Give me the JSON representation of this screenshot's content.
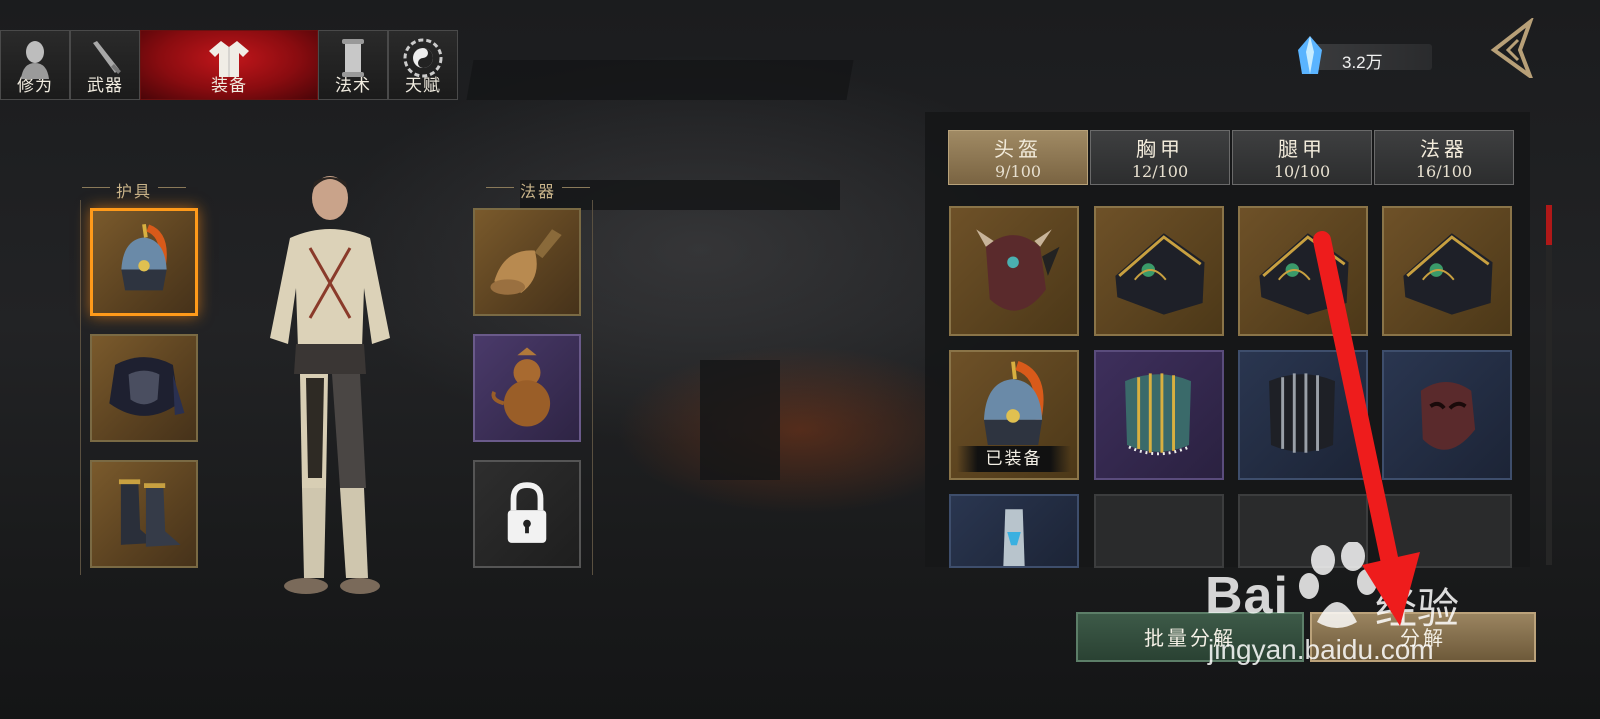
{
  "nav": {
    "tabs": [
      {
        "label": "修为",
        "icon": "cultivator-head-icon"
      },
      {
        "label": "武器",
        "icon": "sword-icon"
      },
      {
        "label": "装备",
        "icon": "robe-icon",
        "active": true
      },
      {
        "label": "法术",
        "icon": "scroll-icon"
      },
      {
        "label": "天赋",
        "icon": "bagua-icon"
      }
    ]
  },
  "currency": {
    "value": "3.2万",
    "icon": "blue-crystal-icon"
  },
  "left": {
    "armor_title": "护具",
    "magic_title": "法器",
    "armor_slots": [
      "helmet-icon",
      "chest-armor-icon",
      "boots-icon"
    ],
    "magic_slots": [
      "bell-icon",
      "gourd-icon",
      "lock-icon"
    ]
  },
  "categories": [
    {
      "name": "头盔",
      "count": "9/100",
      "active": true
    },
    {
      "name": "胸甲",
      "count": "12/100"
    },
    {
      "name": "腿甲",
      "count": "10/100"
    },
    {
      "name": "法器",
      "count": "16/100"
    }
  ],
  "inventory": {
    "equipped_label": "已装备"
  },
  "buttons": {
    "batch_decompose": "批量分解",
    "decompose": "分解"
  },
  "watermark": {
    "brand": "Bai",
    "brand_cn": "经验",
    "url": "jingyan.baidu.com"
  },
  "colors": {
    "active_tab_red": "#c2161b",
    "selected_gold": "#ff9a1a",
    "arrow_red": "#ee1c1c"
  }
}
